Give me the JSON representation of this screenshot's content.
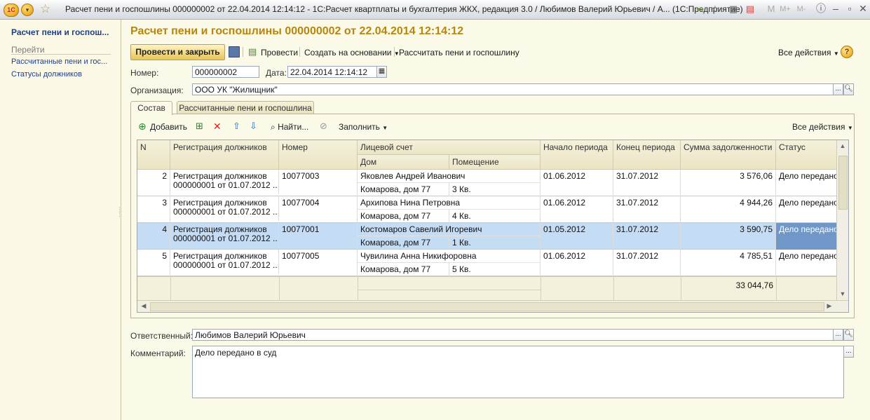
{
  "window": {
    "title": "Расчет пени и госпошлины 000000002 от 22.04.2014 12:14:12 - 1С:Расчет квартплаты и бухгалтерия ЖКХ, редакция 3.0 / Любимов Валерий Юрьевич / А...  (1С:Предприятие)",
    "logo_text": "1С"
  },
  "sidebar": {
    "title": "Расчет пени и госпош...",
    "section": "Перейти",
    "links": [
      "Рассчитанные пени и гос...",
      "Статусы должников"
    ]
  },
  "doc": {
    "title": "Расчет пени и госпошлины 000000002 от 22.04.2014 12:14:12"
  },
  "toolbar": {
    "post_close": "Провести и закрыть",
    "post": "Провести",
    "create_based": "Создать на основании",
    "calc": "Рассчитать пени и госпошлину",
    "all_actions": "Все действия",
    "help": "?"
  },
  "form": {
    "number_label": "Номер:",
    "number_value": "000000002",
    "date_label": "Дата:",
    "date_value": "22.04.2014 12:14:12",
    "org_label": "Организация:",
    "org_value": "ООО УК \"Жилищник\"",
    "resp_label": "Ответственный:",
    "resp_value": "Любимов Валерий Юрьевич",
    "comment_label": "Комментарий:",
    "comment_value": "Дело передано в суд"
  },
  "tabs": [
    "Состав",
    "Рассчитанные пени и госпошлина"
  ],
  "grid_toolbar": {
    "add": "Добавить",
    "find": "Найти...",
    "fill": "Заполнить",
    "all_actions": "Все действия"
  },
  "grid": {
    "headers": {
      "n": "N",
      "reg": "Регистрация должников",
      "num": "Номер",
      "account": "Лицевой счет",
      "house": "Дом",
      "room": "Помещение",
      "start": "Начало периода",
      "end": "Конец периода",
      "debt": "Сумма задолженности",
      "status": "Статус"
    },
    "rows": [
      {
        "n": "2",
        "reg1": "Регистрация должников",
        "reg2": "000000001 от 01.07.2012 ...",
        "num": "10077003",
        "name": "Яковлев Андрей Иванович",
        "house": "Комарова, дом 77",
        "room": "3 Кв.",
        "start": "01.06.2012",
        "end": "31.07.2012",
        "debt": "3 576,06",
        "status": "Дело передано в"
      },
      {
        "n": "3",
        "reg1": "Регистрация должников",
        "reg2": "000000001 от 01.07.2012 ...",
        "num": "10077004",
        "name": "Архипова Нина Петровна",
        "house": "Комарова, дом 77",
        "room": "4 Кв.",
        "start": "01.06.2012",
        "end": "31.07.2012",
        "debt": "4 944,26",
        "status": "Дело передано в"
      },
      {
        "n": "4",
        "reg1": "Регистрация должников",
        "reg2": "000000001 от 01.07.2012 ...",
        "num": "10077001",
        "name": "Костомаров Савелий Игоревич",
        "house": "Комарова, дом 77",
        "room": "1 Кв.",
        "start": "01.05.2012",
        "end": "31.07.2012",
        "debt": "3 590,75",
        "status": "Дело передано в"
      },
      {
        "n": "5",
        "reg1": "Регистрация должников",
        "reg2": "000000001 от 01.07.2012 ...",
        "num": "10077005",
        "name": "Чувилина Анна Никифоровна",
        "house": "Комарова, дом 77",
        "room": "5 Кв.",
        "start": "01.06.2012",
        "end": "31.07.2012",
        "debt": "4 785,51",
        "status": "Дело передано в"
      }
    ],
    "total": "33 044,76"
  },
  "colors": {
    "accent_title": "#b8860b",
    "selected_row": "#c5dcf5",
    "selected_status": "#6f98c8",
    "link": "#1d3f93"
  }
}
